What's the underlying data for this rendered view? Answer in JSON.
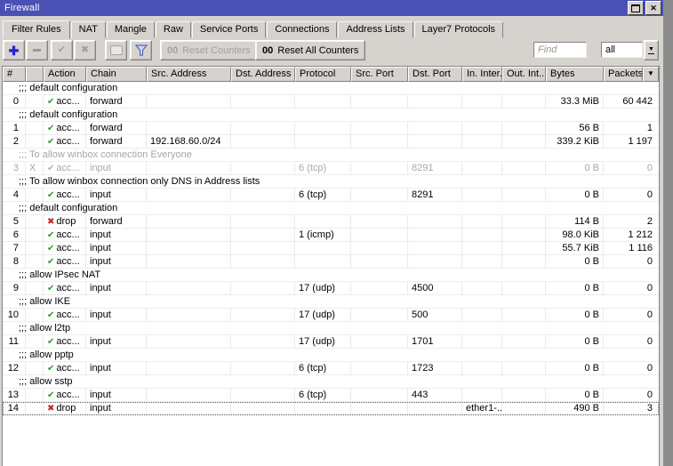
{
  "window": {
    "title": "Firewall"
  },
  "tabs": [
    {
      "label": "Filter Rules",
      "active": true
    },
    {
      "label": "NAT",
      "active": false
    },
    {
      "label": "Mangle",
      "active": false
    },
    {
      "label": "Raw",
      "active": false
    },
    {
      "label": "Service Ports",
      "active": false
    },
    {
      "label": "Connections",
      "active": false
    },
    {
      "label": "Address Lists",
      "active": false
    },
    {
      "label": "Layer7 Protocols",
      "active": false
    }
  ],
  "toolbar": {
    "counters_prefix": "00",
    "reset_counters_label": "Reset Counters",
    "reset_all_counters_label": "Reset All Counters",
    "find_placeholder": "Find",
    "filter_scope_value": "all"
  },
  "icons": {
    "add": "✚",
    "enable": "✔",
    "disable": "✖",
    "accept": "✔",
    "drop": "✖",
    "close": "✕",
    "dropdown": "▼"
  },
  "colors": {
    "titlebar": "#4a50b4",
    "accept_green": "#2f9e2f",
    "drop_red": "#c4271c",
    "add_blue": "#2525cf",
    "disabled_text": "#a9a7a4"
  },
  "table": {
    "columns": [
      {
        "id": "num",
        "label": "#"
      },
      {
        "id": "flag",
        "label": ""
      },
      {
        "id": "action",
        "label": "Action"
      },
      {
        "id": "chain",
        "label": "Chain"
      },
      {
        "id": "src_address",
        "label": "Src. Address"
      },
      {
        "id": "dst_address",
        "label": "Dst. Address"
      },
      {
        "id": "protocol",
        "label": "Protocol"
      },
      {
        "id": "src_port",
        "label": "Src. Port"
      },
      {
        "id": "dst_port",
        "label": "Dst. Port"
      },
      {
        "id": "in_iface",
        "label": "In. Inter..."
      },
      {
        "id": "out_iface",
        "label": "Out. Int..."
      },
      {
        "id": "bytes",
        "label": "Bytes"
      },
      {
        "id": "packets",
        "label": "Packets"
      }
    ],
    "rows": [
      {
        "type": "comment",
        "text": ";;; default configuration",
        "disabled": false
      },
      {
        "type": "rule",
        "num": "0",
        "flag": "",
        "action": "accept",
        "action_label": "acc...",
        "chain": "forward",
        "src_address": "",
        "dst_address": "",
        "protocol": "",
        "src_port": "",
        "dst_port": "",
        "in_iface": "",
        "out_iface": "",
        "bytes": "33.3 MiB",
        "packets": "60 442",
        "disabled": false,
        "focused": false
      },
      {
        "type": "comment",
        "text": ";;; default configuration",
        "disabled": false
      },
      {
        "type": "rule",
        "num": "1",
        "flag": "",
        "action": "accept",
        "action_label": "acc...",
        "chain": "forward",
        "src_address": "",
        "dst_address": "",
        "protocol": "",
        "src_port": "",
        "dst_port": "",
        "in_iface": "",
        "out_iface": "",
        "bytes": "56 B",
        "packets": "1",
        "disabled": false,
        "focused": false
      },
      {
        "type": "rule",
        "num": "2",
        "flag": "",
        "action": "accept",
        "action_label": "acc...",
        "chain": "forward",
        "src_address": "192.168.60.0/24",
        "dst_address": "",
        "protocol": "",
        "src_port": "",
        "dst_port": "",
        "in_iface": "",
        "out_iface": "",
        "bytes": "339.2 KiB",
        "packets": "1 197",
        "disabled": false,
        "focused": false
      },
      {
        "type": "comment",
        "text": ";;; To allow winbox connection Everyone",
        "disabled": true
      },
      {
        "type": "rule",
        "num": "3",
        "flag": "X",
        "action": "accept",
        "action_label": "acc...",
        "chain": "input",
        "src_address": "",
        "dst_address": "",
        "protocol": "6 (tcp)",
        "src_port": "",
        "dst_port": "8291",
        "in_iface": "",
        "out_iface": "",
        "bytes": "0 B",
        "packets": "0",
        "disabled": true,
        "focused": false
      },
      {
        "type": "comment",
        "text": ";;; To allow winbox connection only DNS in Address lists",
        "disabled": false
      },
      {
        "type": "rule",
        "num": "4",
        "flag": "",
        "action": "accept",
        "action_label": "acc...",
        "chain": "input",
        "src_address": "",
        "dst_address": "",
        "protocol": "6 (tcp)",
        "src_port": "",
        "dst_port": "8291",
        "in_iface": "",
        "out_iface": "",
        "bytes": "0 B",
        "packets": "0",
        "disabled": false,
        "focused": false
      },
      {
        "type": "comment",
        "text": ";;; default configuration",
        "disabled": false
      },
      {
        "type": "rule",
        "num": "5",
        "flag": "",
        "action": "drop",
        "action_label": "drop",
        "chain": "forward",
        "src_address": "",
        "dst_address": "",
        "protocol": "",
        "src_port": "",
        "dst_port": "",
        "in_iface": "",
        "out_iface": "",
        "bytes": "114 B",
        "packets": "2",
        "disabled": false,
        "focused": false
      },
      {
        "type": "rule",
        "num": "6",
        "flag": "",
        "action": "accept",
        "action_label": "acc...",
        "chain": "input",
        "src_address": "",
        "dst_address": "",
        "protocol": "1 (icmp)",
        "src_port": "",
        "dst_port": "",
        "in_iface": "",
        "out_iface": "",
        "bytes": "98.0 KiB",
        "packets": "1 212",
        "disabled": false,
        "focused": false
      },
      {
        "type": "rule",
        "num": "7",
        "flag": "",
        "action": "accept",
        "action_label": "acc...",
        "chain": "input",
        "src_address": "",
        "dst_address": "",
        "protocol": "",
        "src_port": "",
        "dst_port": "",
        "in_iface": "",
        "out_iface": "",
        "bytes": "55.7 KiB",
        "packets": "1 116",
        "disabled": false,
        "focused": false
      },
      {
        "type": "rule",
        "num": "8",
        "flag": "",
        "action": "accept",
        "action_label": "acc...",
        "chain": "input",
        "src_address": "",
        "dst_address": "",
        "protocol": "",
        "src_port": "",
        "dst_port": "",
        "in_iface": "",
        "out_iface": "",
        "bytes": "0 B",
        "packets": "0",
        "disabled": false,
        "focused": false
      },
      {
        "type": "comment",
        "text": ";;; allow IPsec NAT",
        "disabled": false
      },
      {
        "type": "rule",
        "num": "9",
        "flag": "",
        "action": "accept",
        "action_label": "acc...",
        "chain": "input",
        "src_address": "",
        "dst_address": "",
        "protocol": "17 (udp)",
        "src_port": "",
        "dst_port": "4500",
        "in_iface": "",
        "out_iface": "",
        "bytes": "0 B",
        "packets": "0",
        "disabled": false,
        "focused": false
      },
      {
        "type": "comment",
        "text": ";;; allow IKE",
        "disabled": false
      },
      {
        "type": "rule",
        "num": "10",
        "flag": "",
        "action": "accept",
        "action_label": "acc...",
        "chain": "input",
        "src_address": "",
        "dst_address": "",
        "protocol": "17 (udp)",
        "src_port": "",
        "dst_port": "500",
        "in_iface": "",
        "out_iface": "",
        "bytes": "0 B",
        "packets": "0",
        "disabled": false,
        "focused": false
      },
      {
        "type": "comment",
        "text": ";;; allow l2tp",
        "disabled": false
      },
      {
        "type": "rule",
        "num": "11",
        "flag": "",
        "action": "accept",
        "action_label": "acc...",
        "chain": "input",
        "src_address": "",
        "dst_address": "",
        "protocol": "17 (udp)",
        "src_port": "",
        "dst_port": "1701",
        "in_iface": "",
        "out_iface": "",
        "bytes": "0 B",
        "packets": "0",
        "disabled": false,
        "focused": false
      },
      {
        "type": "comment",
        "text": ";;; allow pptp",
        "disabled": false
      },
      {
        "type": "rule",
        "num": "12",
        "flag": "",
        "action": "accept",
        "action_label": "acc...",
        "chain": "input",
        "src_address": "",
        "dst_address": "",
        "protocol": "6 (tcp)",
        "src_port": "",
        "dst_port": "1723",
        "in_iface": "",
        "out_iface": "",
        "bytes": "0 B",
        "packets": "0",
        "disabled": false,
        "focused": false
      },
      {
        "type": "comment",
        "text": ";;; allow sstp",
        "disabled": false
      },
      {
        "type": "rule",
        "num": "13",
        "flag": "",
        "action": "accept",
        "action_label": "acc...",
        "chain": "input",
        "src_address": "",
        "dst_address": "",
        "protocol": "6 (tcp)",
        "src_port": "",
        "dst_port": "443",
        "in_iface": "",
        "out_iface": "",
        "bytes": "0 B",
        "packets": "0",
        "disabled": false,
        "focused": false
      },
      {
        "type": "rule",
        "num": "14",
        "flag": "",
        "action": "drop",
        "action_label": "drop",
        "chain": "input",
        "src_address": "",
        "dst_address": "",
        "protocol": "",
        "src_port": "",
        "dst_port": "",
        "in_iface": "ether1-...",
        "out_iface": "",
        "bytes": "490 B",
        "packets": "3",
        "disabled": false,
        "focused": true
      }
    ]
  }
}
